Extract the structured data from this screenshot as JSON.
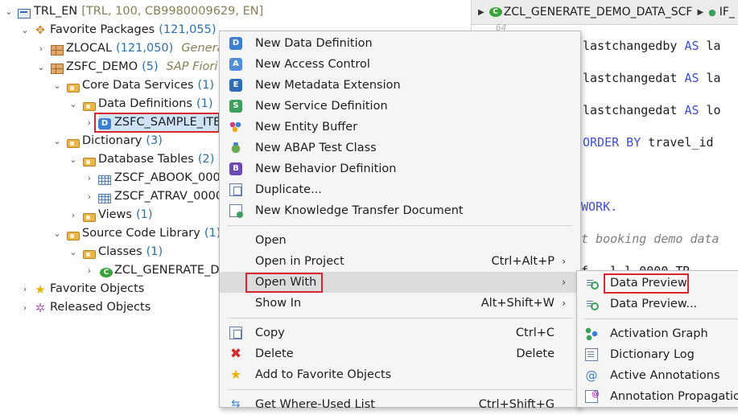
{
  "tree": {
    "project": {
      "label": "TRL_EN",
      "meta": "[TRL, 100, CB9980009629, EN]"
    },
    "favorite_packages": {
      "label": "Favorite Packages",
      "count": "(121,055)"
    },
    "zlocal": {
      "label": "ZLOCAL",
      "count": "(121,050)",
      "desc": "Genera"
    },
    "zsfc_demo": {
      "label": "ZSFC_DEMO",
      "count": "(5)",
      "desc": "SAP Fiori"
    },
    "core_data_services": {
      "label": "Core Data Services",
      "count": "(1)"
    },
    "data_definitions": {
      "label": "Data Definitions",
      "count": "(1)"
    },
    "zsfc_sample_item": {
      "label": "ZSFC_SAMPLE_ITE"
    },
    "dictionary": {
      "label": "Dictionary",
      "count": "(3)"
    },
    "database_tables": {
      "label": "Database Tables",
      "count": "(2)"
    },
    "zscf_abook": {
      "label": "ZSCF_ABOOK_0000"
    },
    "zscf_atrav": {
      "label": "ZSCF_ATRAV_0000"
    },
    "views": {
      "label": "Views",
      "count": "(1)"
    },
    "source_code_library": {
      "label": "Source Code Library",
      "count": "(1)"
    },
    "classes": {
      "label": "Classes",
      "count": "(1)"
    },
    "zcl_generate": {
      "label": "ZCL_GENERATE_DE"
    },
    "favorite_objects": {
      "label": "Favorite Objects"
    },
    "released_objects": {
      "label": "Released Objects"
    }
  },
  "editor": {
    "breadcrumb": {
      "class": "ZCL_GENERATE_DEMO_DATA_SCF",
      "next": "IF_"
    },
    "gutter": "64",
    "lines": {
      "l1_a": "lastchangedby",
      "l1_kw": "AS",
      "l1_b": "la",
      "l2_a": "lastchangedat",
      "l2_kw": "AS",
      "l2_b": "la",
      "l3_a": "lastchangedat",
      "l3_kw": "AS",
      "l3_b": "lo",
      "l4_kw": "ORDER BY",
      "l4_b": "travel_id",
      "l5_kw": "WORK.",
      "l6_cm": "t booking demo data",
      "l7_partial": "f...l-l 0000 TR..."
    }
  },
  "context_menu": {
    "items": [
      {
        "label": "New Data Definition",
        "icon": "data-definition-icon"
      },
      {
        "label": "New Access Control",
        "icon": "access-control-icon"
      },
      {
        "label": "New Metadata Extension",
        "icon": "metadata-extension-icon"
      },
      {
        "label": "New Service Definition",
        "icon": "service-definition-icon"
      },
      {
        "label": "New Entity Buffer",
        "icon": "entity-buffer-icon"
      },
      {
        "label": "New ABAP Test Class",
        "icon": "test-class-icon"
      },
      {
        "label": "New Behavior Definition",
        "icon": "behavior-definition-icon"
      },
      {
        "label": "Duplicate...",
        "icon": "duplicate-icon"
      },
      {
        "label": "New Knowledge Transfer Document",
        "icon": "knowledge-transfer-icon"
      }
    ],
    "open": {
      "label": "Open"
    },
    "open_in_project": {
      "label": "Open in Project",
      "shortcut": "Ctrl+Alt+P"
    },
    "open_with": {
      "label": "Open With"
    },
    "show_in": {
      "label": "Show In",
      "shortcut": "Alt+Shift+W"
    },
    "copy": {
      "label": "Copy",
      "shortcut": "Ctrl+C"
    },
    "delete": {
      "label": "Delete",
      "shortcut": "Delete"
    },
    "add_favorite": {
      "label": "Add to Favorite Objects"
    },
    "where_used": {
      "label": "Get Where-Used List",
      "shortcut": "Ctrl+Shift+G"
    }
  },
  "submenu": {
    "data_preview": "Data Preview",
    "data_preview_dots": "Data Preview...",
    "activation_graph": "Activation Graph",
    "dictionary_log": "Dictionary Log",
    "active_annotations": "Active Annotations",
    "annotation_propagation": "Annotation Propagation"
  },
  "colors": {
    "highlight": "#d9262c",
    "selection": "#cfe3f7",
    "keyword": "#3f4fd8"
  }
}
